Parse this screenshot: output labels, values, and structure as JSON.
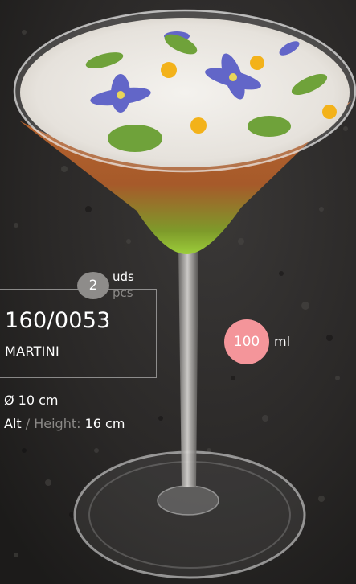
{
  "product": {
    "quantity": "2",
    "quantity_unit_es": "uds",
    "quantity_unit_en": "pcs",
    "reference": "160/0053",
    "name": "MARTINI",
    "diameter": "Ø 10 cm",
    "height_label_es": "Alt",
    "height_separator": " / ",
    "height_label_en": "Height:",
    "height_value": " 16 cm",
    "capacity_value": "100",
    "capacity_unit": "ml"
  },
  "colors": {
    "background": "#262423",
    "quantity_badge": "#8e8c8a",
    "capacity_badge": "#f4959a",
    "secondary_text": "#8a8886"
  }
}
